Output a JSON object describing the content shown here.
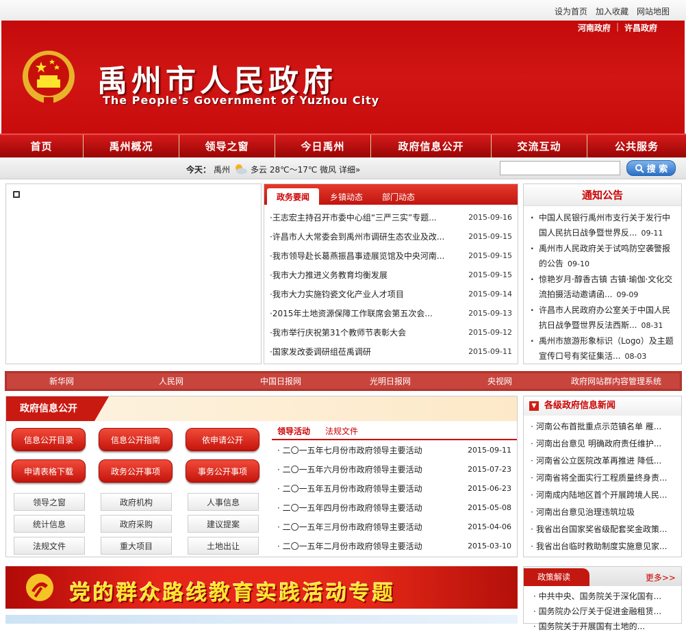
{
  "topbar": {
    "links": [
      "设为首页",
      "加入收藏",
      "网站地图"
    ]
  },
  "banner": {
    "gov_links": [
      "河南政府",
      "许昌政府"
    ],
    "title": "禹州市人民政府",
    "subtitle": "The People's Government of Yuzhou City"
  },
  "nav": [
    "首页",
    "禹州概况",
    "领导之窗",
    "今日禹州",
    "政府信息公开",
    "交流互动",
    "公共服务"
  ],
  "weather": {
    "label": "今天：",
    "city": "禹州",
    "text": "多云 28℃～17℃ 微风 详细»"
  },
  "search": {
    "button": "搜 索",
    "placeholder": ""
  },
  "news": {
    "tabs": [
      "政务要闻",
      "乡镇动态",
      "部门动态"
    ],
    "items": [
      {
        "title": "·王志宏主持召开市委中心组“三严三实”专题...",
        "date": "2015-09-16"
      },
      {
        "title": "·许昌市人大常委会到禹州市调研生态农业及改...",
        "date": "2015-09-15"
      },
      {
        "title": "·我市领导赴长葛燕振昌事迹展览馆及中央河南...",
        "date": "2015-09-15"
      },
      {
        "title": "·我市大力推进义务教育均衡发展",
        "date": "2015-09-15"
      },
      {
        "title": "·我市大力实施钧瓷文化产业人才项目",
        "date": "2015-09-14"
      },
      {
        "title": "·2015年土地资源保障工作联席会第五次会...",
        "date": "2015-09-13"
      },
      {
        "title": "·我市举行庆祝第31个教师节表彰大会",
        "date": "2015-09-12"
      },
      {
        "title": "·国家发改委调研组莅禹调研",
        "date": "2015-09-11"
      }
    ]
  },
  "notice": {
    "title": "通知公告",
    "items": [
      {
        "text": "中国人民银行禹州市支行关于发行中国人民抗日战争暨世界反...",
        "date": "09-11"
      },
      {
        "text": "禹州市人民政府关于试鸣防空袭警报的公告",
        "date": "09-10"
      },
      {
        "text": "惊艳岁月·醇香古镇 古镇·瑜伽·文化交流拍摄活动邀请函...",
        "date": "09-09"
      },
      {
        "text": "许昌市人民政府办公室关于中国人民抗日战争暨世界反法西斯...",
        "date": "08-31"
      },
      {
        "text": "禹州市旅游形象标识（Logo）及主题宣传口号有奖征集活...",
        "date": "08-03"
      }
    ]
  },
  "links_bar": [
    "新华网",
    "人民网",
    "中国日报网",
    "光明日报网",
    "央视网",
    "政府网站群内容管理系统"
  ],
  "info_open": {
    "title": "政府信息公开",
    "red_buttons": [
      "信息公开目录",
      "信息公开指南",
      "依申请公开",
      "申请表格下载",
      "政务公开事项",
      "事务公开事项"
    ],
    "gray_buttons": [
      "领导之窗",
      "政府机构",
      "人事信息",
      "统计信息",
      "政府采购",
      "建议提案",
      "法规文件",
      "重大项目",
      "土地出让"
    ],
    "lead_tabs": [
      "领导活动",
      "法规文件"
    ],
    "lead_items": [
      {
        "title": "· 二〇一五年七月份市政府领导主要活动",
        "date": "2015-09-11"
      },
      {
        "title": "· 二〇一五年六月份市政府领导主要活动",
        "date": "2015-07-23"
      },
      {
        "title": "· 二〇一五年五月份市政府领导主要活动",
        "date": "2015-06-23"
      },
      {
        "title": "· 二〇一五年四月份市政府领导主要活动",
        "date": "2015-05-08"
      },
      {
        "title": "· 二〇一五年三月份市政府领导主要活动",
        "date": "2015-04-06"
      },
      {
        "title": "· 二〇一五年二月份市政府领导主要活动",
        "date": "2015-03-10"
      }
    ]
  },
  "gov_news": {
    "title": "各级政府信息新闻",
    "items": [
      "河南公布首批重点示范镇名单 雁...",
      "河南出台意见 明确政府责任维护...",
      "河南省公立医院改革再推进 降低...",
      "河南省将全面实行工程质量终身责...",
      "河南成内陆地区首个开展跨境人民...",
      "河南出台意见治理违筑垃圾",
      "我省出台国家奖省级配套奖金政策...",
      "我省出台临时救助制度实施意见家..."
    ]
  },
  "campaign": {
    "text": "党的群众路线教育实践活动专题"
  },
  "policy": {
    "title": "政策解读",
    "more": "更多>>",
    "items": [
      "· 中共中央、国务院关于深化国有...",
      "· 国务院办公厅关于促进金融租赁...",
      "· 国务院关于开展国有土地的..."
    ]
  },
  "colors": {
    "brand_red": "#c40a0a",
    "accent_gold": "#fde42a"
  }
}
